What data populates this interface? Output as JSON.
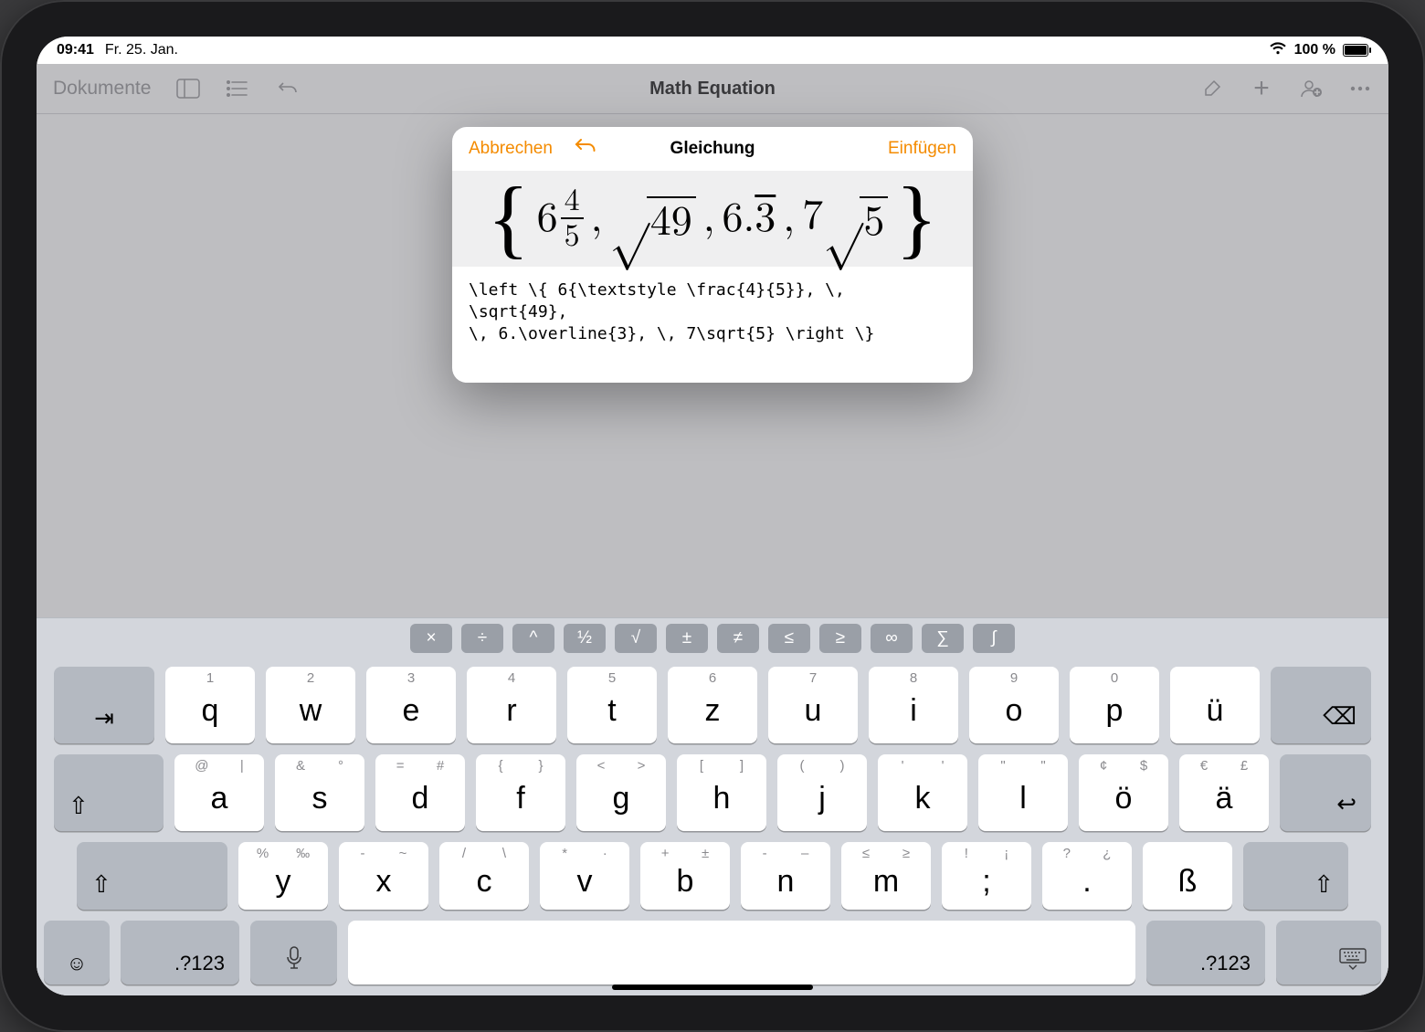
{
  "statusbar": {
    "time": "09:41",
    "date": "Fr. 25. Jan.",
    "battery_pct": "100 %"
  },
  "toolbar": {
    "documents": "Dokumente",
    "doc_title": "Math Equation"
  },
  "modal": {
    "cancel": "Abbrechen",
    "title": "Gleichung",
    "insert": "Einfügen",
    "latex": "\\left \\{ 6{\\textstyle \\frac{4}{5}}, \\,\n\\sqrt{49},\n\\, 6.\\overline{3}, \\, 7\\sqrt{5} \\right \\}"
  },
  "equation": {
    "mixed_whole": "6",
    "mixed_num": "4",
    "mixed_den": "5",
    "sqrt1": "49",
    "dec_int": "6.",
    "dec_rep": "3",
    "coef2": "7",
    "sqrt2": "5"
  },
  "shortcuts": [
    "×",
    "÷",
    "^",
    "½",
    "√",
    "±",
    "≠",
    "≤",
    "≥",
    "∞",
    "∑",
    "∫"
  ],
  "kbd": {
    "row1": [
      {
        "m": "q",
        "a": [
          "1"
        ]
      },
      {
        "m": "w",
        "a": [
          "2"
        ]
      },
      {
        "m": "e",
        "a": [
          "3"
        ]
      },
      {
        "m": "r",
        "a": [
          "4"
        ]
      },
      {
        "m": "t",
        "a": [
          "5"
        ]
      },
      {
        "m": "z",
        "a": [
          "6"
        ]
      },
      {
        "m": "u",
        "a": [
          "7"
        ]
      },
      {
        "m": "i",
        "a": [
          "8"
        ]
      },
      {
        "m": "o",
        "a": [
          "9"
        ]
      },
      {
        "m": "p",
        "a": [
          "0"
        ]
      },
      {
        "m": "ü",
        "a": [
          ""
        ]
      }
    ],
    "row2": [
      {
        "m": "a",
        "a": [
          "@",
          "|"
        ]
      },
      {
        "m": "s",
        "a": [
          "&",
          "°"
        ]
      },
      {
        "m": "d",
        "a": [
          "=",
          "#"
        ]
      },
      {
        "m": "f",
        "a": [
          "{",
          "}"
        ]
      },
      {
        "m": "g",
        "a": [
          "<",
          ">"
        ]
      },
      {
        "m": "h",
        "a": [
          "[",
          "]"
        ]
      },
      {
        "m": "j",
        "a": [
          "(",
          ")"
        ]
      },
      {
        "m": "k",
        "a": [
          "'",
          "'"
        ]
      },
      {
        "m": "l",
        "a": [
          "\"",
          "\""
        ]
      },
      {
        "m": "ö",
        "a": [
          "¢",
          "$"
        ]
      },
      {
        "m": "ä",
        "a": [
          "€",
          "£"
        ]
      }
    ],
    "row3": [
      {
        "m": "y",
        "a": [
          "%",
          "‰"
        ]
      },
      {
        "m": "x",
        "a": [
          "-",
          "~"
        ]
      },
      {
        "m": "c",
        "a": [
          "/",
          "\\"
        ]
      },
      {
        "m": "v",
        "a": [
          "*",
          "·"
        ]
      },
      {
        "m": "b",
        "a": [
          "+",
          "±"
        ]
      },
      {
        "m": "n",
        "a": [
          "-",
          "–"
        ]
      },
      {
        "m": "m",
        "a": [
          "≤",
          "≥"
        ]
      },
      {
        "m": ";",
        "a": [
          "!",
          "¡"
        ]
      },
      {
        "m": ".",
        "a": [
          "?",
          "¿"
        ]
      },
      {
        "m": "ß",
        "a": [
          "",
          ""
        ]
      }
    ],
    "numkey": ".?123"
  }
}
